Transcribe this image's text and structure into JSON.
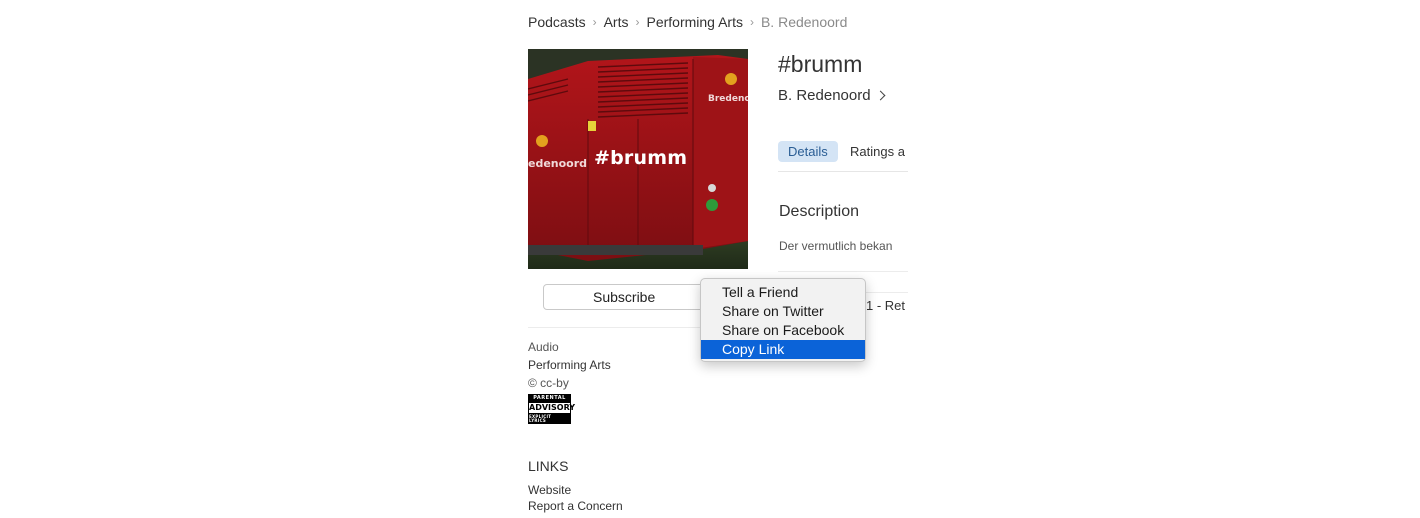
{
  "breadcrumb": {
    "items": [
      "Podcasts",
      "Arts",
      "Performing Arts",
      "B. Redenoord"
    ],
    "separator": "›"
  },
  "artwork": {
    "overlay_title": "#brumm",
    "brand_text": "Bredenoord",
    "brand_text_side": "edenoord",
    "accent_color": "#c8161b"
  },
  "podcast": {
    "title": "#brumm",
    "author": "B. Redenoord"
  },
  "actions": {
    "subscribe_label": "Subscribe"
  },
  "tabs": [
    {
      "label": "Details",
      "active": true
    },
    {
      "label": "Ratings a",
      "active": false
    }
  ],
  "description": {
    "heading": "Description",
    "text": "Der vermutlich bekan"
  },
  "episode_peek": {
    "text": "1 - Ret"
  },
  "meta": {
    "type": "Audio",
    "category": "Performing Arts",
    "copyright": "© cc-by",
    "advisory": {
      "line1": "PARENTAL",
      "line2": "ADVISORY",
      "line3": "EXPLICIT LYRICS"
    }
  },
  "links": {
    "heading": "LINKS",
    "items": [
      "Website",
      "Report a Concern"
    ]
  },
  "context_menu": {
    "items": [
      {
        "label": "Tell a Friend",
        "highlighted": false
      },
      {
        "label": "Share on Twitter",
        "highlighted": false
      },
      {
        "label": "Share on Facebook",
        "highlighted": false
      },
      {
        "label": "Copy Link",
        "highlighted": true
      }
    ],
    "highlight_color": "#0b63d8"
  }
}
